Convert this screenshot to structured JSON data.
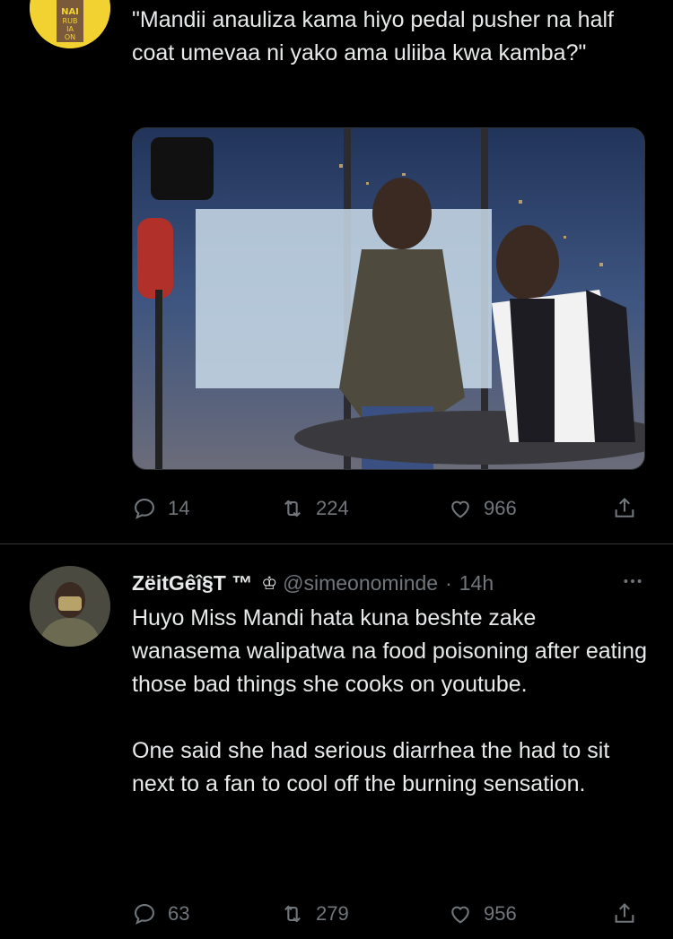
{
  "tweet1": {
    "text": "\"Mandii anauliza kama hiyo pedal pusher na half coat umevaa ni yako ama uliiba kwa kamba?\"",
    "avatar_text": "NAI\nRUB\nIA\nON",
    "stats": {
      "replies": "14",
      "retweets": "224",
      "likes": "966"
    }
  },
  "tweet2": {
    "name": "ZëitGêî§T ™",
    "crown": "♔",
    "handle": "@simeonominde",
    "dot": "·",
    "time": "14h",
    "text": "Huyo Miss Mandi hata kuna beshte zake wanasema walipatwa na food poisoning after eating those bad things she cooks on youtube.\n\nOne said she had serious diarrhea the had to sit next to a fan to cool off the burning sensation.",
    "stats": {
      "replies": "63",
      "retweets": "279",
      "likes": "956"
    }
  },
  "icons": {
    "reply": "reply-icon",
    "retweet": "retweet-icon",
    "like": "heart-icon",
    "share": "share-icon",
    "more": "more-icon"
  },
  "colors": {
    "background": "#000000",
    "text": "#e7e9ea",
    "secondary": "#71767b",
    "divider": "#2f3336"
  }
}
